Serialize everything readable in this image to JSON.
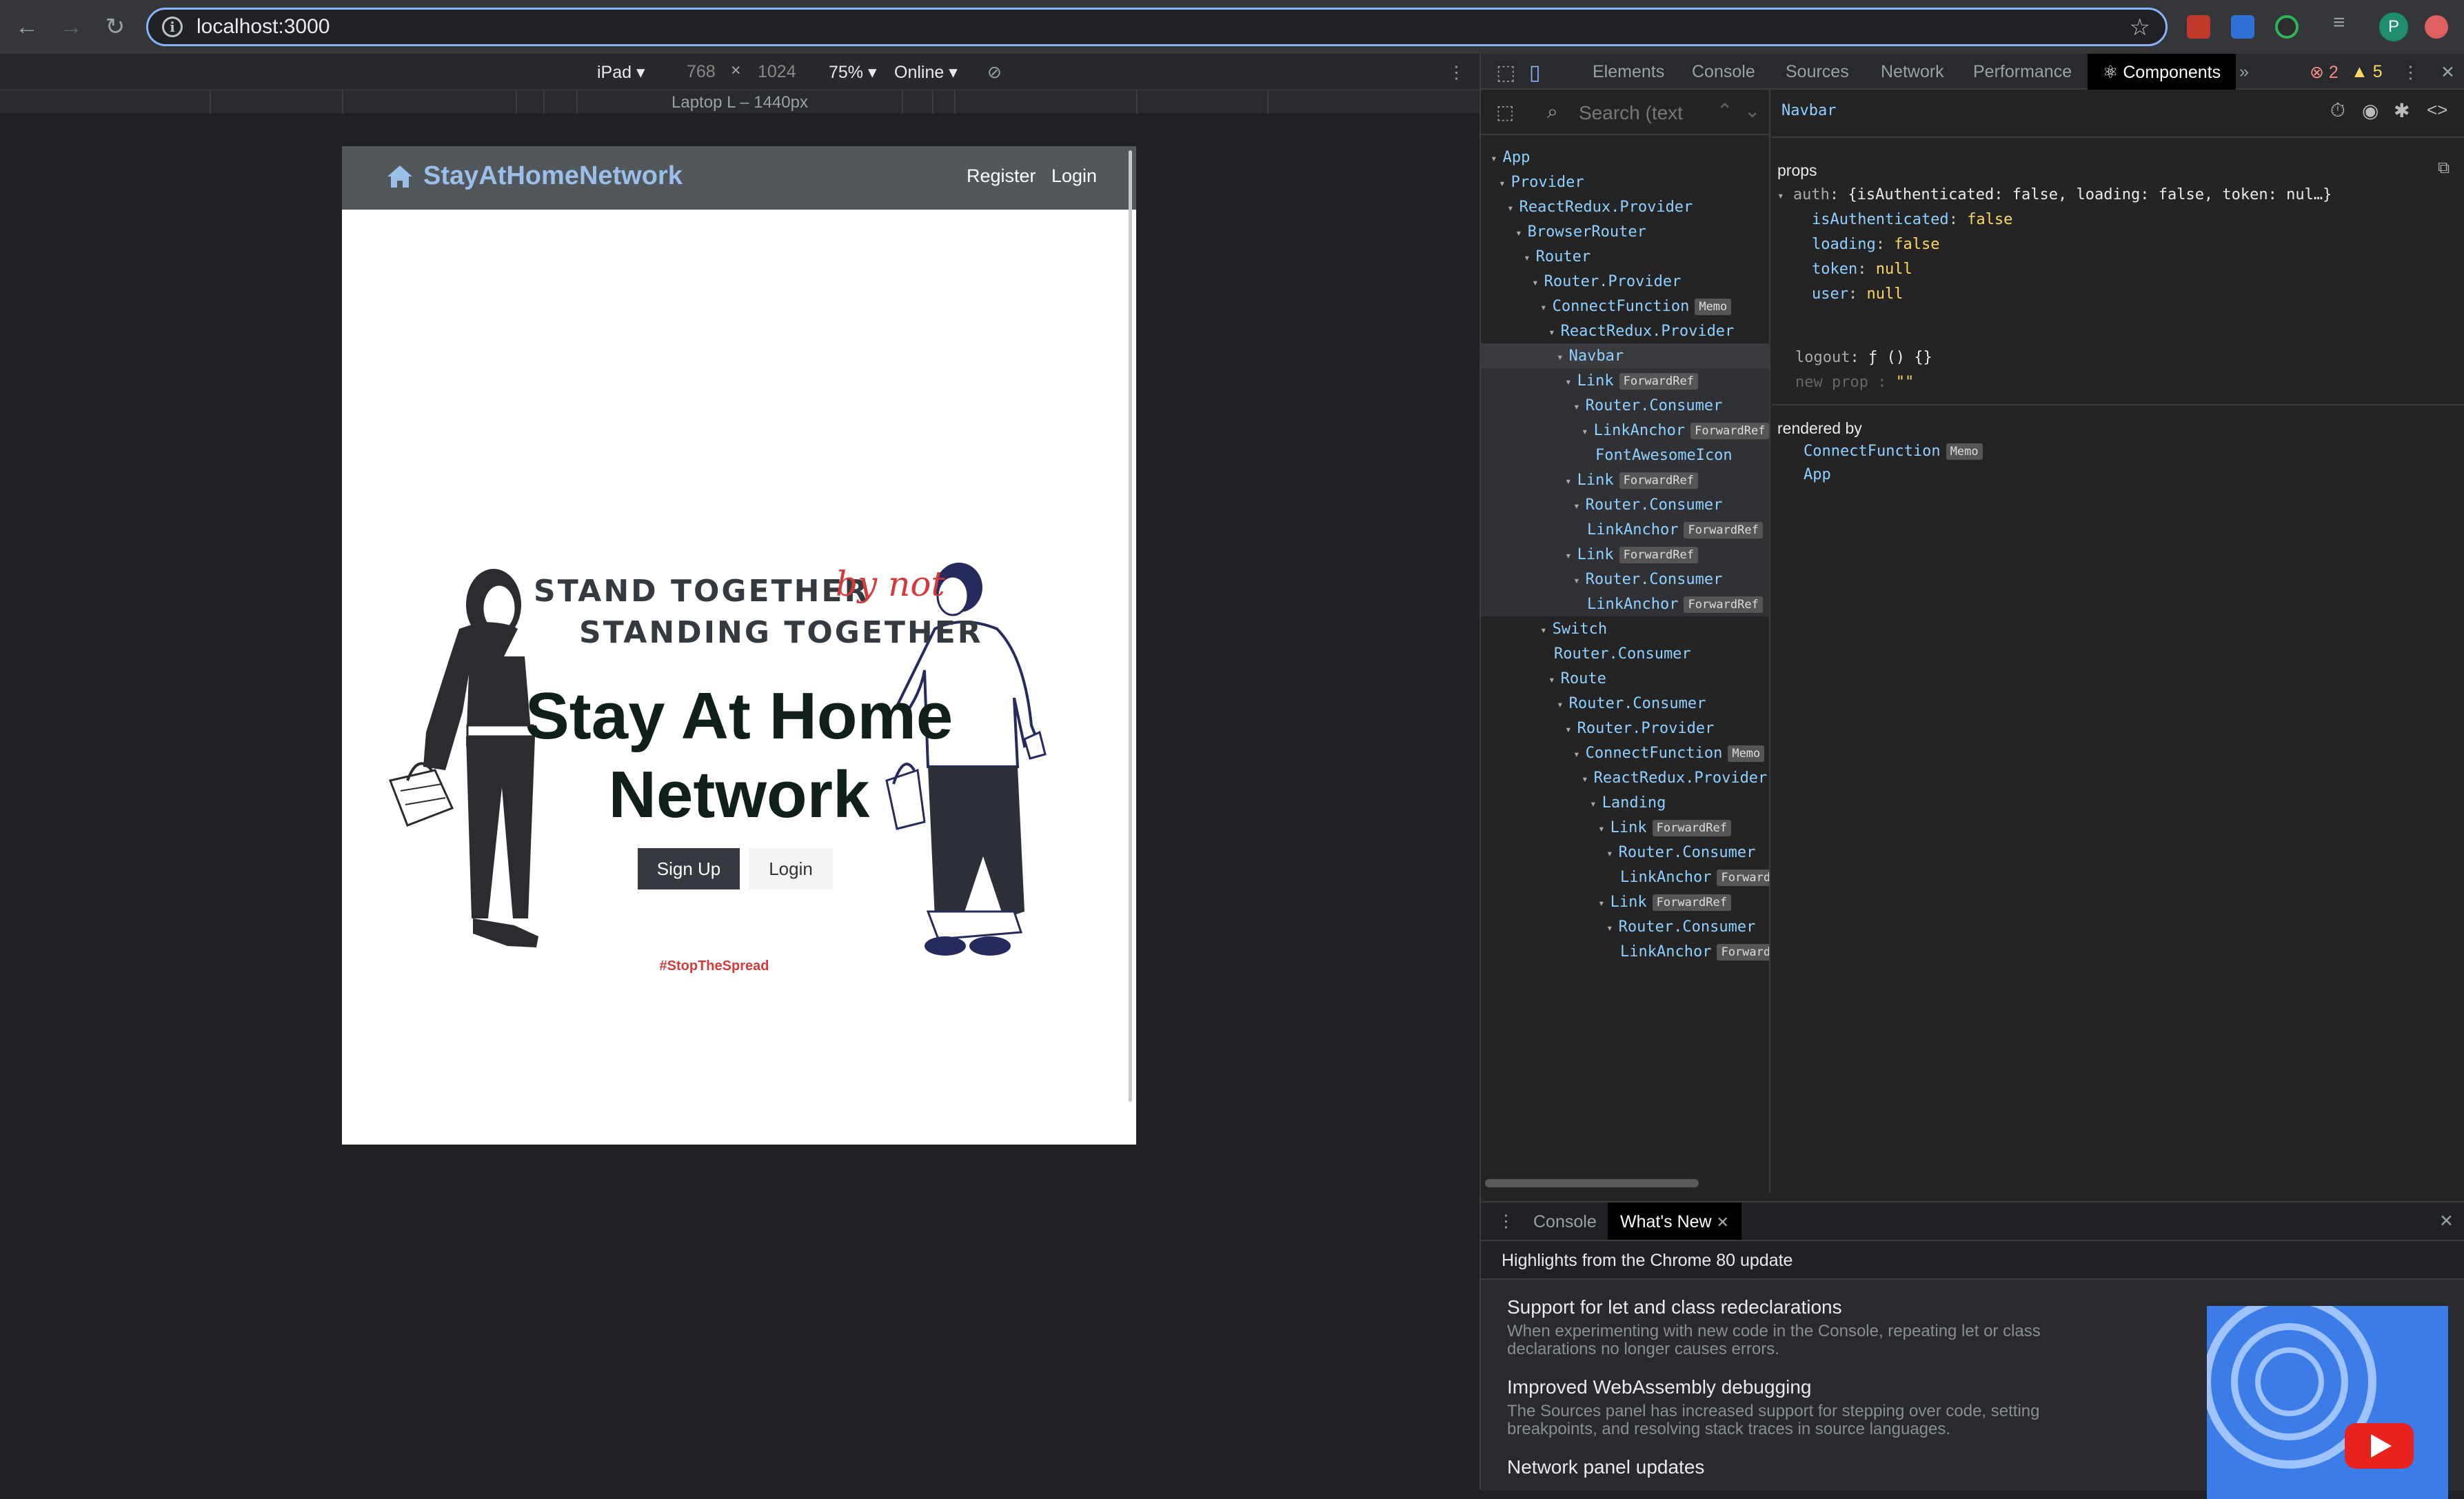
{
  "browser": {
    "url": "localhost:3000",
    "avatar_letter": "P"
  },
  "device_toolbar": {
    "device": "iPad ▾",
    "width": "768",
    "times": "×",
    "height": "1024",
    "zoom": "75% ▾",
    "network": "Online ▾",
    "ruler_label": "Laptop L – 1440px"
  },
  "site": {
    "brand": "StayAtHomeNetwork",
    "nav_register": "Register",
    "nav_login": "Login",
    "stand_line1": "STAND TOGETHER",
    "by_not": "by not",
    "stand_line2": "STANDING TOGETHER",
    "title_line1": "Stay At Home",
    "title_line2": "Network",
    "signup": "Sign Up",
    "login": "Login",
    "hashtag": "#StopTheSpread"
  },
  "devtools": {
    "tabs": [
      "Elements",
      "Console",
      "Sources",
      "Network",
      "Performance",
      "Components"
    ],
    "active_tab": "Components",
    "errors": "2",
    "warnings": "5",
    "search_placeholder": "Search (text",
    "selected_component": "Navbar",
    "tree": [
      {
        "label": "App",
        "indent": 0,
        "badge": ""
      },
      {
        "label": "Provider",
        "indent": 1,
        "badge": ""
      },
      {
        "label": "ReactRedux.Provider",
        "indent": 2,
        "badge": ""
      },
      {
        "label": "BrowserRouter",
        "indent": 3,
        "badge": ""
      },
      {
        "label": "Router",
        "indent": 4,
        "badge": ""
      },
      {
        "label": "Router.Provider",
        "indent": 5,
        "badge": ""
      },
      {
        "label": "ConnectFunction",
        "indent": 6,
        "badge": "Memo"
      },
      {
        "label": "ReactRedux.Provider",
        "indent": 7,
        "badge": ""
      },
      {
        "label": "Navbar",
        "indent": 8,
        "badge": ""
      },
      {
        "label": "Link",
        "indent": 9,
        "badge": "ForwardRef"
      },
      {
        "label": "Router.Consumer",
        "indent": 10,
        "badge": ""
      },
      {
        "label": "LinkAnchor",
        "indent": 11,
        "badge": "ForwardRef"
      },
      {
        "label": "FontAwesomeIcon",
        "indent": 12,
        "badge": ""
      },
      {
        "label": "Link",
        "indent": 9,
        "badge": "ForwardRef"
      },
      {
        "label": "Router.Consumer",
        "indent": 10,
        "badge": ""
      },
      {
        "label": "LinkAnchor",
        "indent": 11,
        "badge": "ForwardRef"
      },
      {
        "label": "Link",
        "indent": 9,
        "badge": "ForwardRef"
      },
      {
        "label": "Router.Consumer",
        "indent": 10,
        "badge": ""
      },
      {
        "label": "LinkAnchor",
        "indent": 11,
        "badge": "ForwardRef"
      },
      {
        "label": "Switch",
        "indent": 6,
        "badge": ""
      },
      {
        "label": "Router.Consumer",
        "indent": 7,
        "badge": ""
      },
      {
        "label": "Route",
        "indent": 7,
        "badge": ""
      },
      {
        "label": "Router.Consumer",
        "indent": 8,
        "badge": ""
      },
      {
        "label": "Router.Provider",
        "indent": 9,
        "badge": ""
      },
      {
        "label": "ConnectFunction",
        "indent": 10,
        "badge": "Memo"
      },
      {
        "label": "ReactRedux.Provider",
        "indent": 11,
        "badge": ""
      },
      {
        "label": "Landing",
        "indent": 12,
        "badge": ""
      },
      {
        "label": "Link",
        "indent": 13,
        "badge": "ForwardRef"
      },
      {
        "label": "Router.Consumer",
        "indent": 14,
        "badge": ""
      },
      {
        "label": "LinkAnchor",
        "indent": 15,
        "badge": "ForwardRef"
      },
      {
        "label": "Link",
        "indent": 13,
        "badge": "ForwardRef"
      },
      {
        "label": "Router.Consumer",
        "indent": 14,
        "badge": ""
      },
      {
        "label": "LinkAnchor",
        "indent": 15,
        "badge": "ForwardRef"
      }
    ],
    "props_title": "props",
    "props": {
      "auth_summary": "{isAuthenticated: false, loading: false, token: nul…}",
      "rows": [
        {
          "key": "isAuthenticated",
          "value": "false"
        },
        {
          "key": "loading",
          "value": "false"
        },
        {
          "key": "token",
          "value": "null"
        },
        {
          "key": "user",
          "value": "null"
        }
      ],
      "logout_key": "logout",
      "logout_value": "ƒ () {}",
      "new_prop": "new prop",
      "new_prop_value": "\"\""
    },
    "rendered_by_title": "rendered by",
    "rendered_by": [
      "ConnectFunction",
      "App"
    ],
    "rendered_by_badge": "Memo"
  },
  "drawer": {
    "tabs": [
      "Console",
      "What's New"
    ],
    "active_tab": "What's New",
    "highlights": "Highlights from the Chrome 80 update",
    "items": [
      {
        "title": "Support for let and class redeclarations",
        "desc": "When experimenting with new code in the Console, repeating let or class declarations no longer causes errors."
      },
      {
        "title": "Improved WebAssembly debugging",
        "desc": "The Sources panel has increased support for stepping over code, setting breakpoints, and resolving stack traces in source languages."
      },
      {
        "title": "Network panel updates",
        "desc": ""
      }
    ]
  },
  "colors": {
    "accent_blue": "#8ab4f8",
    "brand_blue": "#8ab4e4",
    "tag_red": "#d43a3a",
    "nav_dark": "#343a40"
  }
}
